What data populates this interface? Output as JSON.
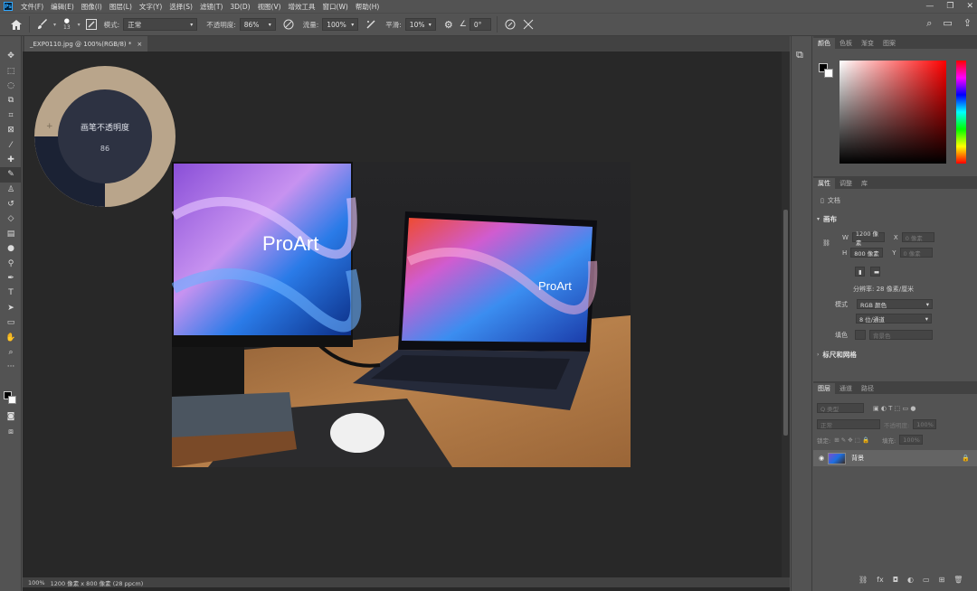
{
  "menubar": {
    "logo": "Ps",
    "items": [
      "文件(F)",
      "编辑(E)",
      "图像(I)",
      "图层(L)",
      "文字(Y)",
      "选择(S)",
      "滤镜(T)",
      "3D(D)",
      "视图(V)",
      "增效工具",
      "窗口(W)",
      "帮助(H)"
    ],
    "window_controls": [
      "—",
      "❐",
      "✕"
    ]
  },
  "options": {
    "brush_size": "13",
    "mode_label": "模式:",
    "mode_value": "正常",
    "opacity_label": "不透明度:",
    "opacity_value": "86%",
    "flow_label": "流量:",
    "flow_value": "100%",
    "smoothing_label": "平滑:",
    "smoothing_value": "10%",
    "angle_value": "0°"
  },
  "document": {
    "tab_title": "_EXP0110.jpg @ 100%(RGB/8) *",
    "tab_close": "×"
  },
  "hud": {
    "label": "画笔不透明度",
    "value": "86"
  },
  "status": {
    "zoom": "100%",
    "info": "1200 像素 x 800 像素 (28 ppcm)"
  },
  "color_panel": {
    "tabs": [
      "颜色",
      "色板",
      "渐变",
      "图案"
    ]
  },
  "properties": {
    "tabs": [
      "属性",
      "调整",
      "库"
    ],
    "doc_label": "文档",
    "canvas_section": "画布",
    "w_label": "W",
    "w_value": "1200 像素",
    "h_label": "H",
    "h_value": "800 像素",
    "x_label": "X",
    "x_value": "0 像素",
    "y_label": "Y",
    "y_value": "0 像素",
    "resolution": "分辨率: 28 像素/厘米",
    "mode_label": "模式",
    "mode_value": "RGB 颜色",
    "depth_value": "8 位/通道",
    "fill_label": "填色",
    "fill_value": "背景色",
    "rulers_section": "标尺和网格"
  },
  "layers": {
    "tabs": [
      "图层",
      "通道",
      "路径"
    ],
    "kind_placeholder": "Q 类型",
    "blend_mode": "正常",
    "opacity_label": "不透明度:",
    "opacity_value": "100%",
    "lock_label": "锁定:",
    "fill_label": "填充:",
    "fill_value": "100%",
    "layer_name": "背景"
  },
  "image": {
    "monitor_brand": "ProArt",
    "laptop_brand": "ProArt"
  }
}
